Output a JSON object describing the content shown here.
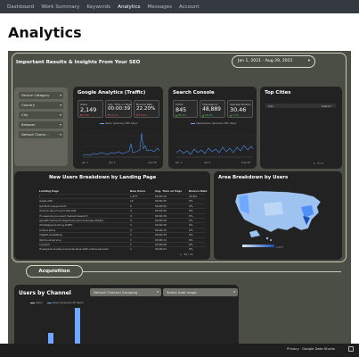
{
  "nav": {
    "items": [
      {
        "label": "Dashboard",
        "active": false
      },
      {
        "label": "Work Summary",
        "active": false
      },
      {
        "label": "Keywords",
        "active": false
      },
      {
        "label": "Analytics",
        "active": true
      },
      {
        "label": "Messages",
        "active": false
      },
      {
        "label": "Account",
        "active": false
      }
    ]
  },
  "page": {
    "title": "Analytics"
  },
  "report": {
    "header": "Important Results & Insights From Your SEO",
    "date_range": "Jan 1, 2021 - Aug 29, 2021",
    "caret": "▾",
    "filters": [
      "Device Category",
      "Country",
      "City",
      "Browser",
      "Default Chann..."
    ],
    "ga": {
      "title": "Google Analytics (Traffic)",
      "scorecards": [
        {
          "label": "Users",
          "value": "2,149",
          "delta": "▼ 9.9%",
          "up": false
        },
        {
          "label": "Avg. Time on Page",
          "value": "00:00:39",
          "delta": "▼ 16.7%",
          "up": false
        },
        {
          "label": "Bounce Rate",
          "value": "22.20%",
          "delta": "▼ 18.2%",
          "up": false
        }
      ],
      "legend": "Users (previous 365 days)",
      "x_ticks": [
        "Jan 1",
        "Feb 1",
        "Mar 1",
        "Apr 1",
        "May 1",
        "Jun 1",
        "Jul 1",
        "Aug 29"
      ]
    },
    "sc": {
      "title": "Search Console",
      "scorecards": [
        {
          "label": "Clicks",
          "value": "845",
          "delta": "▲ 85.4%",
          "up": true
        },
        {
          "label": "Impressions",
          "value": "48,889",
          "delta": "▲ 18.4%",
          "up": true
        },
        {
          "label": "Average Position",
          "value": "30.46",
          "delta": "▲ 3.3%",
          "up": true
        }
      ],
      "legend": "Impressions (previous 365 days)",
      "x_ticks": [
        "Jan 1",
        "Feb 1",
        "Mar 1",
        "Apr 1",
        "May 1",
        "Jun 1",
        "Jul 1",
        "Aug 29"
      ]
    },
    "cities": {
      "title": "Top Cities",
      "col_city": "City",
      "col_users": "Users ▾",
      "pager": "1 - 5 / 5"
    },
    "landing": {
      "title": "New Users Breakdown by Landing Page",
      "cols": [
        "Landing Page",
        "New Users",
        "Avg. Time on Page",
        "Bounce Rate"
      ],
      "rows": [
        [
          "/",
          "1,077",
          "00:00:20",
          "25.8%"
        ],
        [
          "/page-with",
          "12",
          "00:00:35",
          "0%"
        ],
        [
          "/perfect-new-product",
          "6",
          "00:00:50",
          "0%"
        ],
        [
          "/how-to-launch-your-site-fast",
          "4",
          "00:00:40",
          "0%"
        ],
        [
          "/5-reasons-you-need-market-research",
          "4",
          "00:00:30",
          "0%"
        ],
        [
          "/growth-hacks-for-beginners-your-business-starter",
          "3",
          "00:00:25",
          "0%"
        ],
        [
          "/strategies-to-bring-traffic",
          "3",
          "00:00:45",
          "0%"
        ],
        [
          "/online-store",
          "2",
          "00:00:15",
          "0%"
        ],
        [
          "/digital-marketing",
          "2",
          "00:00:33",
          "0%"
        ],
        [
          "/terms-of-service",
          "1",
          "00:00:12",
          "0%"
        ],
        [
          "/contact",
          "1",
          "00:00:08",
          "0%"
        ],
        [
          "/5-ways-to-boost-your-local-store-with-online-services",
          "1",
          "00:00:41",
          "0%"
        ]
      ],
      "pager": "1 - 50 / 70"
    },
    "map": {
      "title": "Area Breakdown by Users",
      "scale_max": "1,077"
    },
    "acquisition": {
      "label": "Acquisition"
    },
    "channel": {
      "title": "Users by Channel",
      "dropdown1": "Default Channel Grouping",
      "dropdown2": "Select date range",
      "legend1": "Users",
      "legend2": "Users (previous 28 days)"
    }
  },
  "viewer": {
    "privacy": "Privacy",
    "brand": "Google Data Studio"
  },
  "colors": {
    "navbar": "#343a40",
    "report_bg": "#4b4e44",
    "card_bg": "#222222",
    "accent_blue": "#4f8ff7",
    "delta_down": "#e05050",
    "delta_up": "#4cc04c"
  }
}
